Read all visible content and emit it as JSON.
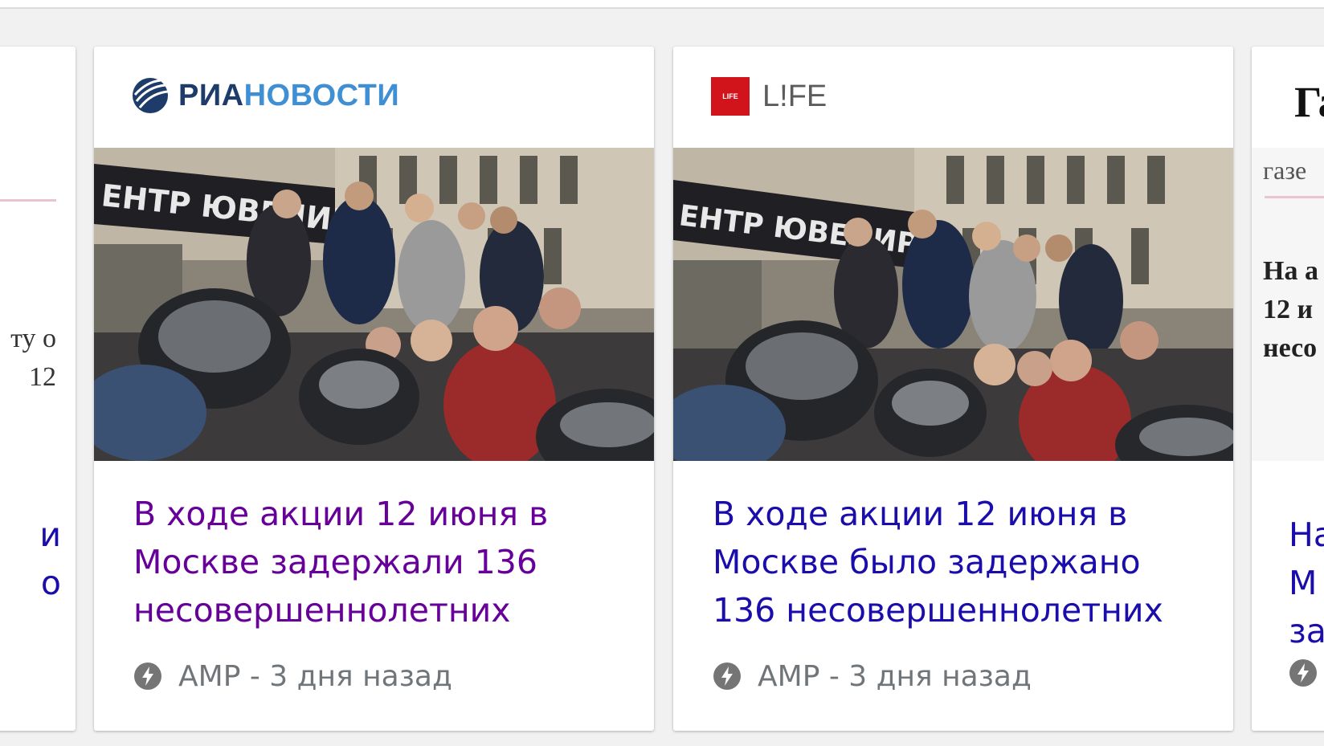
{
  "cards": [
    {
      "source": "РИАНОВОСТИ",
      "source_part1": "РИА",
      "source_part2": "НОВОСТИ",
      "title": "В ходе акции 12 июня в Москве задержали 136 несовершеннолетних",
      "meta": "AMP - 3 дня назад",
      "title_color": "#660099"
    },
    {
      "source": "L!FE",
      "source_badge": "LIFE",
      "title": "В ходе акции 12 июня в Москве было задержано 136 несовершеннолетних",
      "meta": "AMP - 3 дня назад",
      "title_color": "#1a0dab"
    }
  ],
  "left_partial": {
    "snippet_lines": [
      "ту о",
      "12"
    ],
    "title_lines": [
      "и",
      "о"
    ]
  },
  "right_partial": {
    "logo": "Га",
    "snippet_header": "газе",
    "snippet_lines": [
      "На а",
      "12 и",
      "несо"
    ],
    "title_lines": [
      "На",
      "М",
      "за"
    ]
  },
  "icons": {
    "amp": "amp-bolt-icon",
    "ria": "ria-globe-icon",
    "life": "life-logo-icon"
  },
  "colors": {
    "link_visited": "#660099",
    "link": "#1a0dab",
    "meta": "#70757a",
    "life_red": "#d1131b",
    "ria_dark": "#1d3c6a",
    "ria_light": "#3e8fd3"
  }
}
